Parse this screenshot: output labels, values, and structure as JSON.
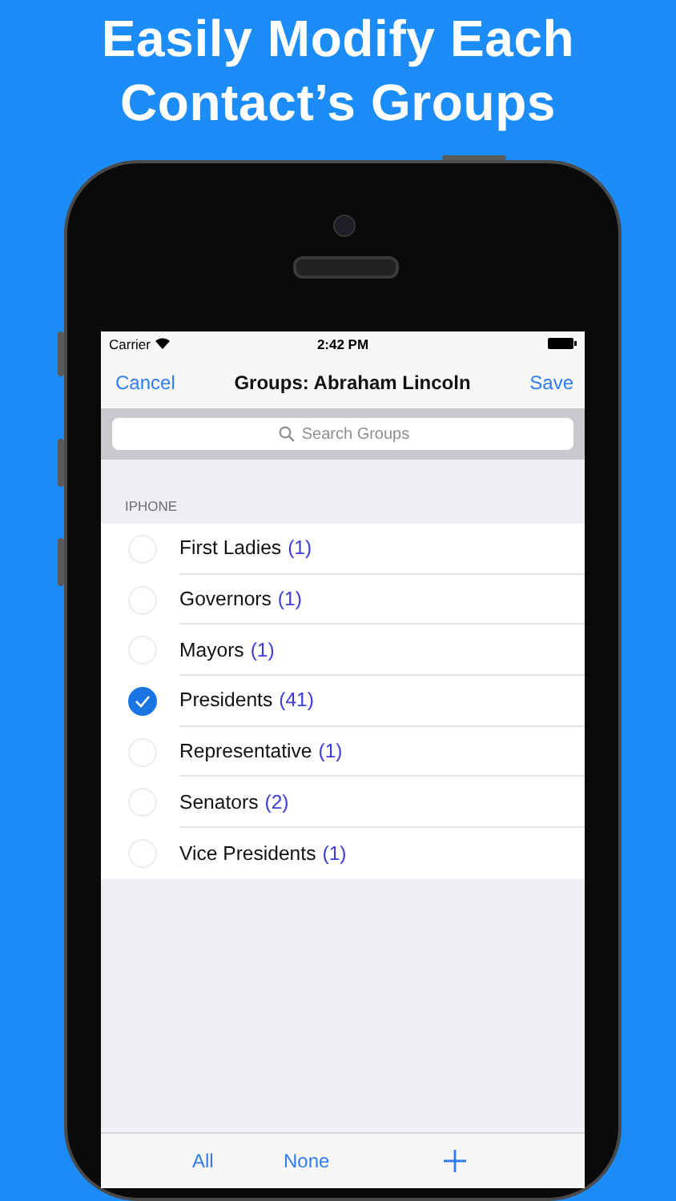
{
  "headline": [
    "Easily Modify Each",
    "Contact’s Groups"
  ],
  "status_bar": {
    "carrier": "Carrier",
    "time": "2:42 PM"
  },
  "nav": {
    "left": "Cancel",
    "title": "Groups: Abraham Lincoln",
    "right": "Save"
  },
  "search": {
    "placeholder": "Search Groups"
  },
  "section": "IPHONE",
  "groups": [
    {
      "name": "First Ladies",
      "count": "(1)",
      "selected": false
    },
    {
      "name": "Governors",
      "count": "(1)",
      "selected": false
    },
    {
      "name": "Mayors",
      "count": "(1)",
      "selected": false
    },
    {
      "name": "Presidents",
      "count": "(41)",
      "selected": true
    },
    {
      "name": "Representative",
      "count": "(1)",
      "selected": false
    },
    {
      "name": "Senators",
      "count": "(2)",
      "selected": false
    },
    {
      "name": "Vice Presidents",
      "count": "(1)",
      "selected": false
    }
  ],
  "toolbar": [
    {
      "kind": "text",
      "label": "All"
    },
    {
      "kind": "text",
      "label": "None"
    },
    {
      "kind": "add"
    }
  ]
}
